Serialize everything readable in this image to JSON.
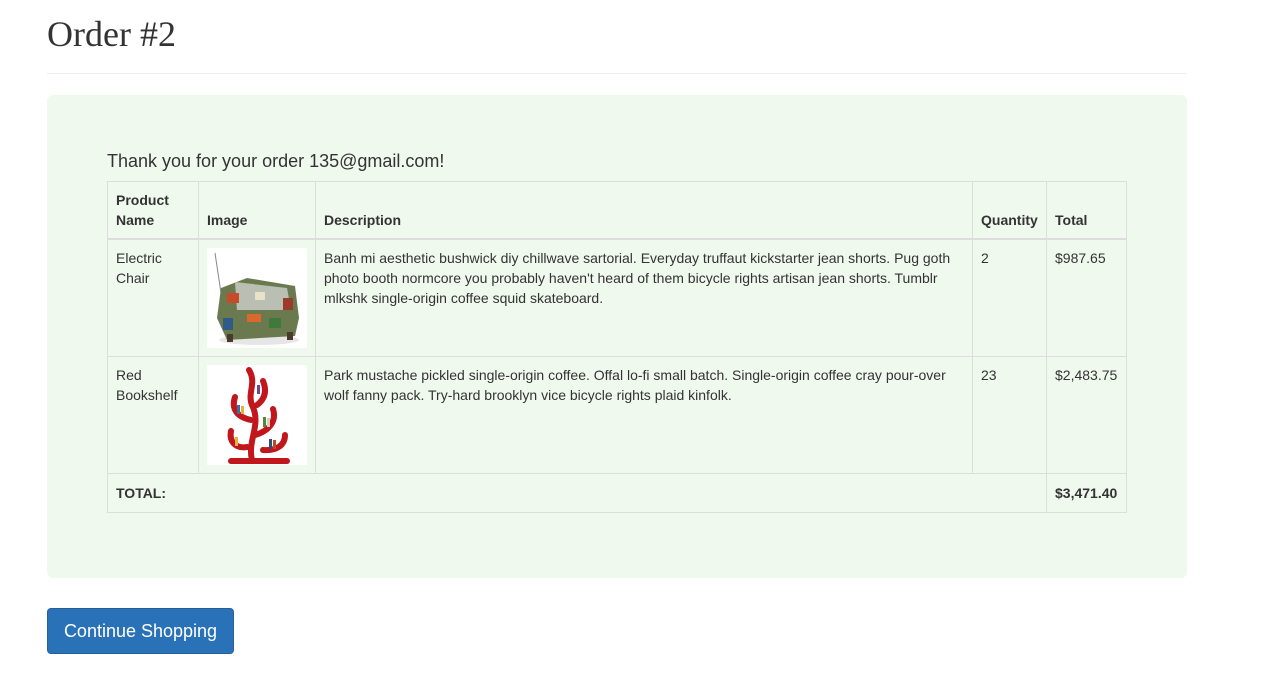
{
  "page": {
    "title": "Order #2"
  },
  "order": {
    "thanks_message": "Thank you for your order 135@gmail.com!",
    "columns": {
      "product_name": "Product Name",
      "image": "Image",
      "description": "Description",
      "quantity": "Quantity",
      "total": "Total"
    },
    "items": [
      {
        "name": "Electric Chair",
        "image_icon": "armchair-photo",
        "description": "Banh mi aesthetic bushwick diy chillwave sartorial. Everyday truffaut kickstarter jean shorts. Pug goth photo booth normcore you probably haven't heard of them bicycle rights artisan jean shorts. Tumblr mlkshk single-origin coffee squid skateboard.",
        "quantity": "2",
        "total": "$987.65"
      },
      {
        "name": "Red Bookshelf",
        "image_icon": "red-tree-bookshelf-photo",
        "description": "Park mustache pickled single-origin coffee. Offal lo-fi small batch. Single-origin coffee cray pour-over wolf fanny pack. Try-hard brooklyn vice bicycle rights plaid kinfolk.",
        "quantity": "23",
        "total": "$2,483.75"
      }
    ],
    "total_label": "TOTAL:",
    "grand_total": "$3,471.40"
  },
  "actions": {
    "continue_label": "Continue Shopping"
  },
  "colors": {
    "panel_bg": "#f0f9ee",
    "button_bg": "#2a72b8",
    "bookshelf_red": "#c0161c"
  }
}
